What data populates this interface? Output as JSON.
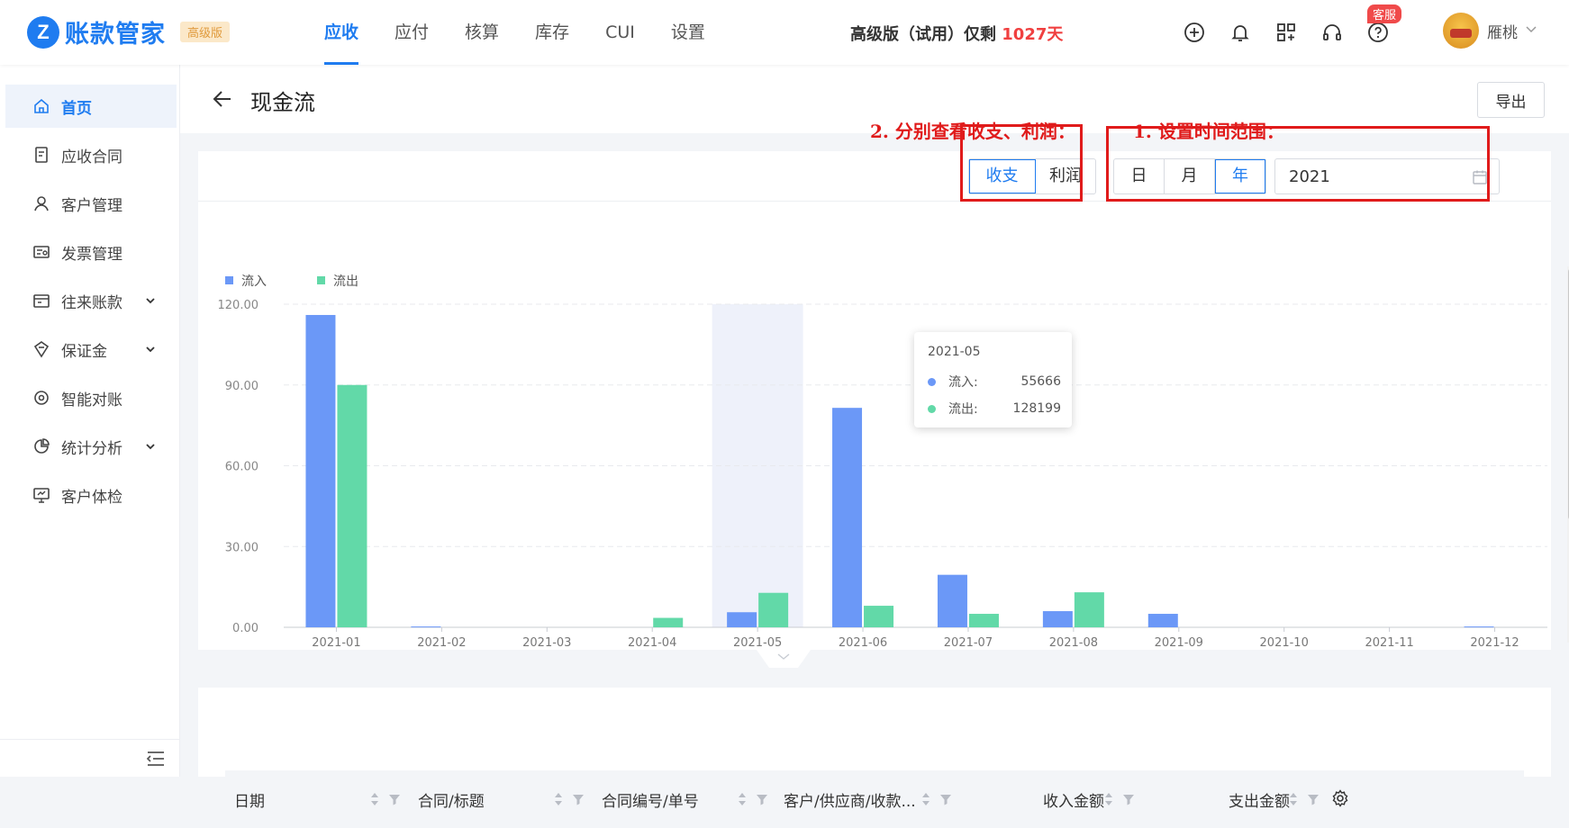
{
  "app": {
    "logo_letter": "Z",
    "name": "账款管家",
    "edition": "高级版",
    "brand_color": "#1f7cf0"
  },
  "topnav": {
    "tabs": [
      {
        "label": "应收",
        "active": true
      },
      {
        "label": "应付",
        "active": false
      },
      {
        "label": "核算",
        "active": false
      },
      {
        "label": "库存",
        "active": false
      },
      {
        "label": "CUI",
        "active": false
      },
      {
        "label": "设置",
        "active": false
      }
    ]
  },
  "trial": {
    "text": "高级版（试用）仅剩 ",
    "days": "1027天"
  },
  "header_icons": [
    "plus-circle-icon",
    "bell-icon",
    "apps-icon",
    "headset-icon",
    "help-icon"
  ],
  "kefu_badge": "客服",
  "user": {
    "name": "雁桃"
  },
  "sidebar": {
    "items": [
      {
        "label": "首页",
        "icon": "home-icon",
        "active": true,
        "expandable": false
      },
      {
        "label": "应收合同",
        "icon": "contract-icon",
        "active": false,
        "expandable": false
      },
      {
        "label": "客户管理",
        "icon": "customer-icon",
        "active": false,
        "expandable": false
      },
      {
        "label": "发票管理",
        "icon": "invoice-icon",
        "active": false,
        "expandable": false
      },
      {
        "label": "往来账款",
        "icon": "account-icon",
        "active": false,
        "expandable": true
      },
      {
        "label": "保证金",
        "icon": "deposit-icon",
        "active": false,
        "expandable": true
      },
      {
        "label": "智能对账",
        "icon": "reconcile-icon",
        "active": false,
        "expandable": false
      },
      {
        "label": "统计分析",
        "icon": "pie-chart-icon",
        "active": false,
        "expandable": true
      },
      {
        "label": "客户体检",
        "icon": "monitor-icon",
        "active": false,
        "expandable": false
      }
    ]
  },
  "page": {
    "title": "现金流",
    "export_label": "导出"
  },
  "annotations": {
    "view_hint": "2. 分别查看收支、利润：",
    "range_hint": "1. 设置时间范围："
  },
  "view_toggle": {
    "options": [
      "收支",
      "利润"
    ],
    "selected": "收支"
  },
  "period_toggle": {
    "options": [
      "日",
      "月",
      "年"
    ],
    "selected": "年"
  },
  "date_picker": {
    "value": "2021"
  },
  "tooltip": {
    "title": "2021-05",
    "rows": [
      {
        "name": "流入:",
        "value": "55666"
      },
      {
        "name": "流出:",
        "value": "128199"
      }
    ]
  },
  "chart_data": {
    "type": "bar",
    "categories": [
      "2021-01",
      "2021-02",
      "2021-03",
      "2021-04",
      "2021-05",
      "2021-06",
      "2021-07",
      "2021-08",
      "2021-09",
      "2021-10",
      "2021-11",
      "2021-12"
    ],
    "series": [
      {
        "name": "流入",
        "color": "#6b98f7",
        "values": [
          116,
          0.3,
          0,
          0,
          5.6,
          81.5,
          19.5,
          6,
          5,
          0,
          0,
          0.3
        ]
      },
      {
        "name": "流出",
        "color": "#62d9a8",
        "values": [
          90,
          0,
          0,
          3.5,
          12.8,
          8,
          5,
          13,
          0,
          0,
          0,
          0
        ]
      }
    ],
    "y_ticks": [
      "0.00",
      "30.00",
      "60.00",
      "90.00",
      "120.00"
    ],
    "ylim": [
      0,
      120
    ],
    "highlight_category": "2021-05",
    "grid": true,
    "legend_position": "top-left"
  },
  "table": {
    "columns": [
      "日期",
      "合同/标题",
      "合同编号/单号",
      "客户/供应商/收款...",
      "收入金额",
      "支出金额"
    ]
  }
}
